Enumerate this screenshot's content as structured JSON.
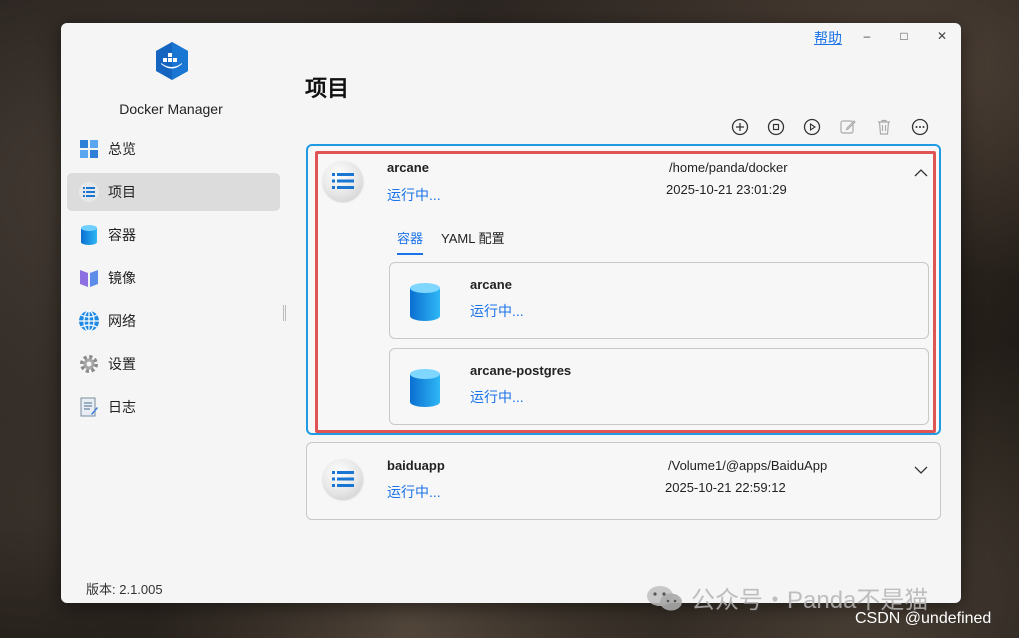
{
  "app": {
    "name": "Docker Manager",
    "version": "版本: 2.1.005"
  },
  "titlebar": {
    "help": "帮助",
    "minimize": "–",
    "maximize": "□",
    "close": "✕"
  },
  "nav": [
    {
      "label": "总览",
      "icon": "dashboard-icon"
    },
    {
      "label": "项目",
      "icon": "list-icon",
      "active": true
    },
    {
      "label": "容器",
      "icon": "container-icon"
    },
    {
      "label": "镜像",
      "icon": "image-icon"
    },
    {
      "label": "网络",
      "icon": "network-icon"
    },
    {
      "label": "设置",
      "icon": "gear-icon"
    },
    {
      "label": "日志",
      "icon": "log-icon"
    }
  ],
  "page": {
    "title": "项目"
  },
  "toolbar": [
    "add-icon",
    "stop-icon",
    "play-icon",
    "edit-icon",
    "delete-icon",
    "more-icon"
  ],
  "projects": [
    {
      "name": "arcane",
      "status": "运行中...",
      "path": "/home/panda/docker",
      "time": "2025-10-21 23:01:29",
      "expanded": true,
      "tabs": [
        "容器",
        "YAML 配置"
      ],
      "containers": [
        {
          "name": "arcane",
          "status": "运行中..."
        },
        {
          "name": "arcane-postgres",
          "status": "运行中..."
        }
      ]
    },
    {
      "name": "baiduapp",
      "status": "运行中...",
      "path": "/Volume1/@apps/BaiduApp",
      "time": "2025-10-21 22:59:12",
      "expanded": false
    }
  ],
  "watermarks": {
    "wechat": "公众号・Panda不是猫",
    "csdn": "CSDN @undefined"
  },
  "colors": {
    "accent": "#1a73e8",
    "selected_border": "#1e9be3",
    "highlight": "#e05454"
  }
}
